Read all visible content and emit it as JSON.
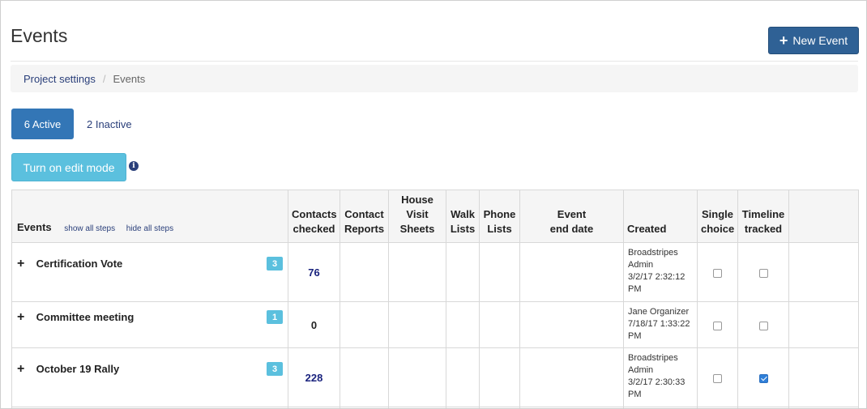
{
  "header": {
    "title": "Events",
    "new_event_label": "New Event"
  },
  "breadcrumb": {
    "parent": "Project settings",
    "current": "Events"
  },
  "tabs": {
    "active_label": "6 Active",
    "inactive_label": "2 Inactive"
  },
  "edit_mode_label": "Turn on edit mode",
  "table": {
    "headers": {
      "events": "Events",
      "show_all_steps": "show all steps",
      "hide_all_steps": "hide all steps",
      "contacts_checked_1": "Contacts",
      "contacts_checked_2": "checked",
      "contact_reports_1": "Contact",
      "contact_reports_2": "Reports",
      "house_visit_1": "House",
      "house_visit_2": "Visit",
      "house_visit_3": "Sheets",
      "walk_lists_1": "Walk",
      "walk_lists_2": "Lists",
      "phone_lists_1": "Phone",
      "phone_lists_2": "Lists",
      "event_end_1": "Event",
      "event_end_2": "end date",
      "created": "Created",
      "single_choice_1": "Single",
      "single_choice_2": "choice",
      "timeline_tracked_1": "Timeline",
      "timeline_tracked_2": "tracked"
    },
    "rows": [
      {
        "name": "Certification Vote",
        "badge": "3",
        "contacts_checked": "76",
        "created_line1": "Broadstripes",
        "created_line2": "Admin",
        "created_line3": "3/2/17 2:32:12",
        "created_line4": "PM",
        "single_choice": false,
        "timeline_tracked": false
      },
      {
        "name": "Committee meeting",
        "badge": "1",
        "contacts_checked": "0",
        "created_line1": "Jane Organizer",
        "created_line2": "7/18/17 1:33:22",
        "created_line3": "PM",
        "single_choice": false,
        "timeline_tracked": false
      },
      {
        "name": "October 19 Rally",
        "badge": "3",
        "contacts_checked": "228",
        "created_line1": "Broadstripes",
        "created_line2": "Admin",
        "created_line3": "3/2/17 2:30:33",
        "created_line4": "PM",
        "single_choice": false,
        "timeline_tracked": true
      }
    ]
  },
  "colors": {
    "primary": "#2f6195",
    "tab_active": "#3376b6",
    "info": "#5bc0de",
    "link": "#2a3f7a"
  },
  "icons": {
    "new_event": "plus-icon",
    "info": "info-circle-icon",
    "expand": "plus-icon"
  }
}
